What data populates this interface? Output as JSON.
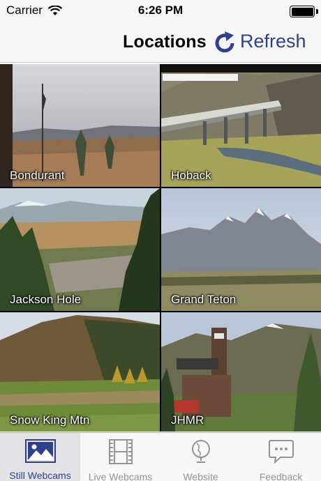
{
  "status_bar": {
    "carrier": "Carrier",
    "time": "6:26 PM"
  },
  "nav": {
    "title": "Locations",
    "refresh_label": "Refresh"
  },
  "webcams": [
    {
      "label": "Bondurant"
    },
    {
      "label": "Hoback"
    },
    {
      "label": "Jackson Hole"
    },
    {
      "label": "Grand Teton"
    },
    {
      "label": "Snow King Mtn"
    },
    {
      "label": "JHMR"
    }
  ],
  "tabs": [
    {
      "label": "Still Webcams",
      "active": true
    },
    {
      "label": "Live Webcams",
      "active": false
    },
    {
      "label": "Website",
      "active": false
    },
    {
      "label": "Feedback",
      "active": false
    }
  ],
  "colors": {
    "accent": "#2f3f8c",
    "inactive": "#949494"
  }
}
